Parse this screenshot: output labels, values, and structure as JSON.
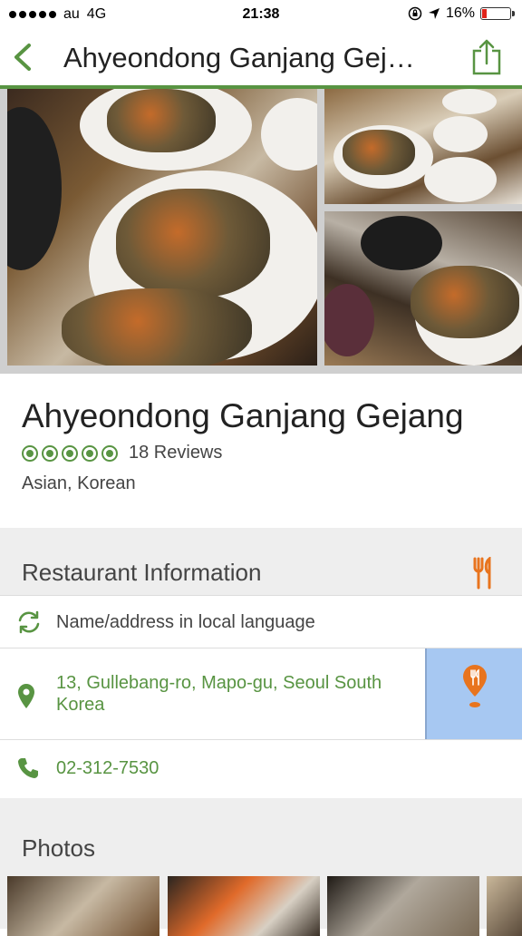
{
  "status_bar": {
    "carrier": "au",
    "network": "4G",
    "time": "21:38",
    "battery": "16%",
    "battery_level": 0.16
  },
  "nav": {
    "title": "Ahyeondong Ganjang Gej…",
    "back_icon": "chevron-left-icon",
    "share_icon": "share-icon"
  },
  "restaurant": {
    "name": "Ahyeondong Ganjang Gejang",
    "rating": 5,
    "reviews": "18 Reviews",
    "cuisine": "Asian, Korean"
  },
  "restaurant_info": {
    "heading": "Restaurant Information",
    "local_language": "Name/address in local language",
    "address": "13, Gullebang-ro, Mapo-gu, Seoul South Korea",
    "phone": "02-312-7530"
  },
  "photos": {
    "heading": "Photos"
  },
  "colors": {
    "accent_green": "#589442",
    "accent_orange": "#e8741e",
    "map_blue": "#a7c8f2"
  }
}
